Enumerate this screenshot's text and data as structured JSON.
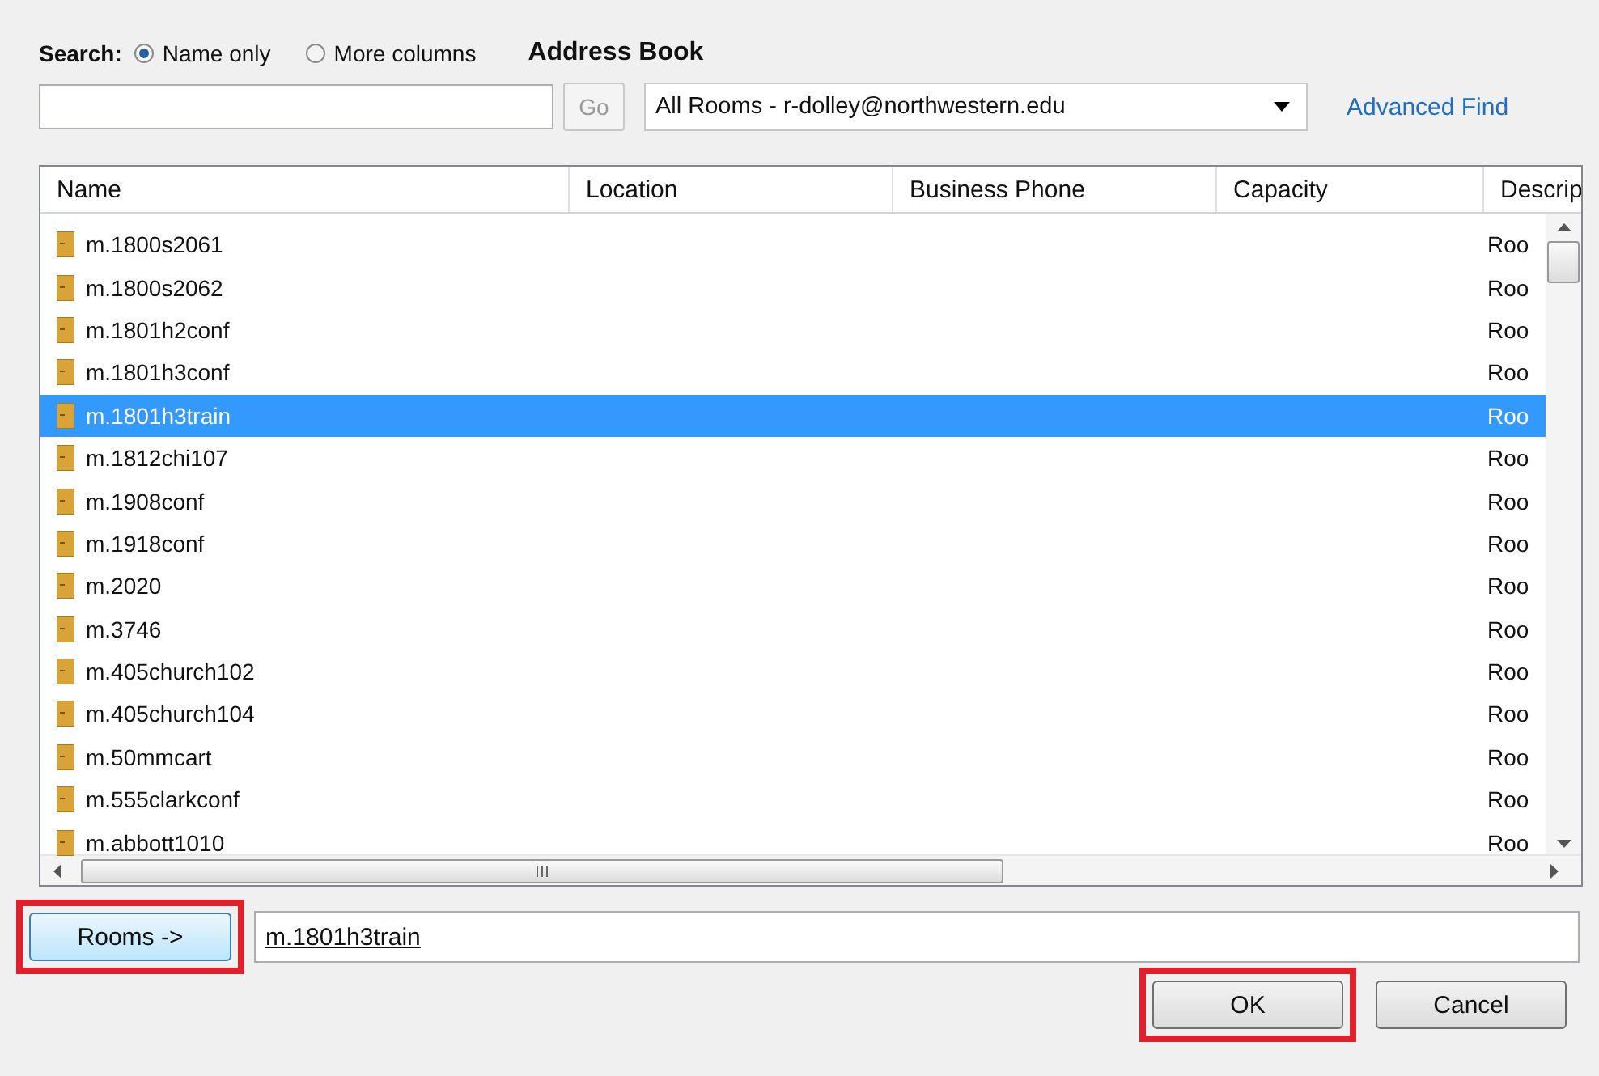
{
  "search": {
    "label": "Search:",
    "options": [
      {
        "label": "Name only",
        "selected": true
      },
      {
        "label": "More columns",
        "selected": false
      }
    ],
    "go_button": "Go"
  },
  "address_book": {
    "label": "Address Book",
    "value": "All Rooms - r-dolley@northwestern.edu",
    "link": "Advanced Find"
  },
  "table": {
    "columns": [
      "Name",
      "Location",
      "Business Phone",
      "Capacity",
      "Descrip"
    ],
    "rows": [
      {
        "name": "m.1800s2061",
        "description": "Roo",
        "selected": false
      },
      {
        "name": "m.1800s2062",
        "description": "Roo",
        "selected": false
      },
      {
        "name": "m.1801h2conf",
        "description": "Roo",
        "selected": false
      },
      {
        "name": "m.1801h3conf",
        "description": "Roo",
        "selected": false
      },
      {
        "name": "m.1801h3train",
        "description": "Roo",
        "selected": true
      },
      {
        "name": "m.1812chi107",
        "description": "Roo",
        "selected": false
      },
      {
        "name": "m.1908conf",
        "description": "Roo",
        "selected": false
      },
      {
        "name": "m.1918conf",
        "description": "Roo",
        "selected": false
      },
      {
        "name": "m.2020",
        "description": "Roo",
        "selected": false
      },
      {
        "name": "m.3746",
        "description": "Roo",
        "selected": false
      },
      {
        "name": "m.405church102",
        "description": "Roo",
        "selected": false
      },
      {
        "name": "m.405church104",
        "description": "Roo",
        "selected": false
      },
      {
        "name": "m.50mmcart",
        "description": "Roo",
        "selected": false
      },
      {
        "name": "m.555clarkconf",
        "description": "Roo",
        "selected": false
      },
      {
        "name": "m.abbott1010",
        "description": "Roo",
        "selected": false
      }
    ]
  },
  "rooms_button": {
    "label": "Rooms ->",
    "highlighted": true
  },
  "rooms_value": "m.1801h3train",
  "buttons": [
    {
      "label": "OK",
      "highlighted": true
    },
    {
      "label": "Cancel",
      "highlighted": false
    }
  ]
}
